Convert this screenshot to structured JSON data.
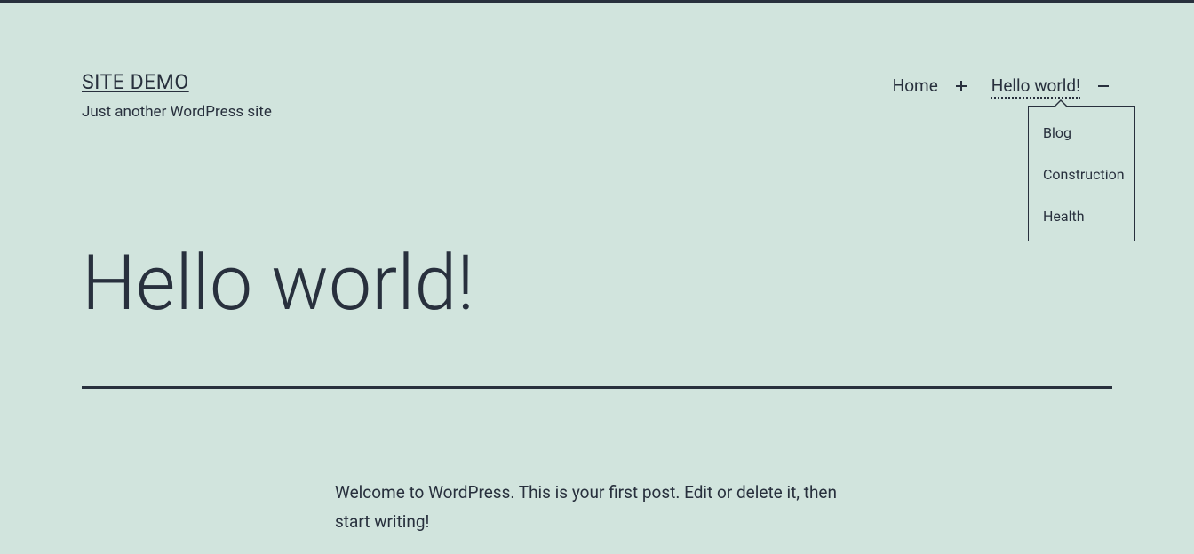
{
  "branding": {
    "title": "SITE DEMO",
    "tagline": "Just another WordPress site"
  },
  "nav": {
    "items": [
      {
        "label": "Home",
        "current": false,
        "expanded": false
      },
      {
        "label": "Hello world!",
        "current": true,
        "expanded": true
      }
    ],
    "submenu": [
      {
        "label": "Blog"
      },
      {
        "label": "Construction"
      },
      {
        "label": "Health"
      }
    ]
  },
  "post": {
    "title": "Hello world!",
    "body": "Welcome to WordPress. This is your first post. Edit or delete it, then start writing!"
  }
}
